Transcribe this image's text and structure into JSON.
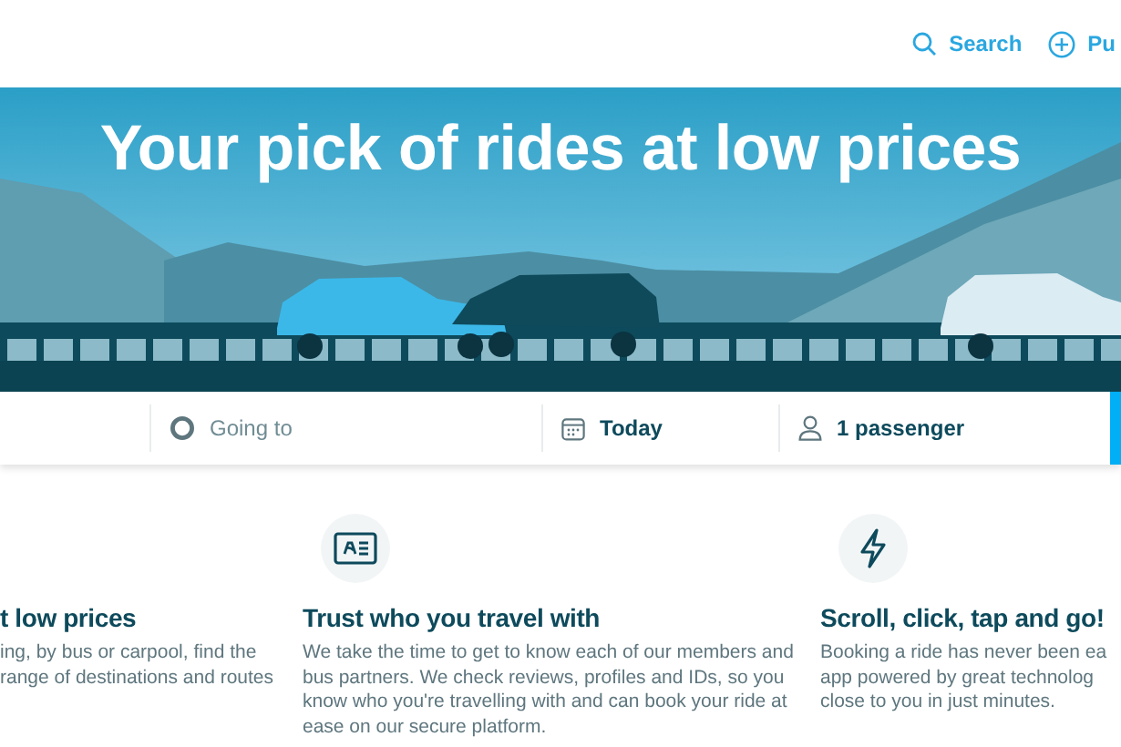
{
  "header": {
    "links": [
      {
        "kind": "search",
        "label": "Search"
      },
      {
        "kind": "publish",
        "label": "Pu"
      }
    ]
  },
  "hero": {
    "title": "Your pick of rides at low prices"
  },
  "search_bar": {
    "fields": [
      {
        "kind": "destination",
        "placeholder": "Going to"
      },
      {
        "kind": "date",
        "value": "Today"
      },
      {
        "kind": "passengers",
        "value": "1 passenger"
      }
    ]
  },
  "features": [
    {
      "kind": "none",
      "title": "t low prices",
      "lines": [
        "ing, by bus or carpool, find the",
        "range of destinations and routes"
      ]
    },
    {
      "kind": "id-card",
      "title": "Trust who you travel with",
      "lines": [
        "We take the time to get to know each of our members and",
        "bus partners. We check reviews, profiles and IDs, so you",
        "know who you're travelling with and can book your ride at",
        "ease on our secure platform."
      ]
    },
    {
      "kind": "bolt",
      "title": "Scroll, click, tap and go!",
      "lines": [
        "Booking a ride has never been ea",
        "app powered by great technolog",
        "close to you in just minutes."
      ]
    }
  ]
}
